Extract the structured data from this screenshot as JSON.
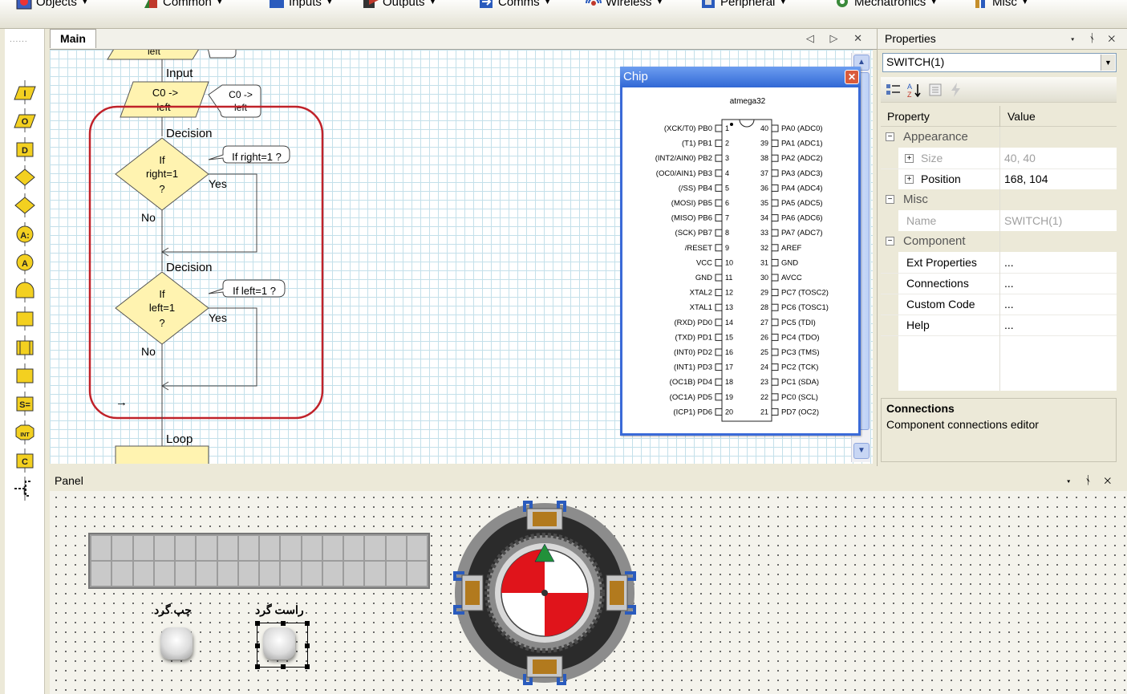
{
  "toolbar": {
    "items": [
      {
        "label": "Objects",
        "color": "#3b5fbf"
      },
      {
        "label": "Common",
        "color": "#2f7d2f"
      },
      {
        "label": "Inputs",
        "color": "#c0392b"
      },
      {
        "label": "Outputs",
        "color": "#b03a2e"
      },
      {
        "label": "Comms",
        "color": "#2a5bbd"
      },
      {
        "label": "Wireless",
        "color": "#c0392b"
      },
      {
        "label": "Peripheral",
        "color": "#2a5bbd"
      },
      {
        "label": "Mechatronics",
        "color": "#3a8a3a"
      },
      {
        "label": "Misc",
        "color": "#c58e2a"
      }
    ]
  },
  "palette": {
    "icons": [
      "input-icon",
      "output-icon",
      "delay-icon",
      "decision-icon",
      "switch-icon",
      "calculation-icon",
      "connection-point-icon",
      "macro-icon",
      "component-macro-icon",
      "loop-icon",
      "call-macro-icon",
      "string-icon",
      "interrupt-icon",
      "c-code-icon",
      "comment-icon"
    ],
    "labels": [
      "I",
      "O",
      "D",
      "",
      "",
      "A:",
      "A",
      "",
      "",
      "",
      "",
      "S=",
      "INT",
      "C",
      "[ "
    ]
  },
  "main_tab": {
    "label": "Main",
    "controls": "◁ ▷ ✕"
  },
  "flowchart": {
    "input_top_label": "left",
    "input_label": "Input",
    "input_text_1": "C0 ->",
    "input_text_2": "left",
    "input_comment_1": "C0 ->",
    "input_comment_2": "left",
    "decision1_label": "Decision",
    "decision1_text_1": "If",
    "decision1_text_2": "right=1",
    "decision1_text_3": "?",
    "decision1_comment": "If right=1 ?",
    "decision1_yes": "Yes",
    "decision1_no": "No",
    "decision2_label": "Decision",
    "decision2_text_1": "If",
    "decision2_text_2": "left=1",
    "decision2_text_3": "?",
    "decision2_comment": "If left=1 ?",
    "decision2_yes": "Yes",
    "decision2_no": "No",
    "arrow_marker": "→",
    "loop_label": "Loop"
  },
  "chip": {
    "title": "Chip",
    "part": "atmega32",
    "left_pins": [
      "(XCK/T0) PB0",
      "(T1) PB1",
      "(INT2/AIN0) PB2",
      "(OC0/AIN1) PB3",
      "(/SS) PB4",
      "(MOSI) PB5",
      "(MISO) PB6",
      "(SCK) PB7",
      "/RESET",
      "VCC",
      "GND",
      "XTAL2",
      "XTAL1",
      "(RXD) PD0",
      "(TXD) PD1",
      "(INT0) PD2",
      "(INT1) PD3",
      "(OC1B) PD4",
      "(OC1A) PD5",
      "(ICP1) PD6"
    ],
    "right_pins": [
      "PA0 (ADC0)",
      "PA1 (ADC1)",
      "PA2 (ADC2)",
      "PA3 (ADC3)",
      "PA4 (ADC4)",
      "PA5 (ADC5)",
      "PA6 (ADC6)",
      "PA7 (ADC7)",
      "AREF",
      "GND",
      "AVCC",
      "PC7 (TOSC2)",
      "PC6 (TOSC1)",
      "PC5 (TDI)",
      "PC4 (TDO)",
      "PC3 (TMS)",
      "PC2 (TCK)",
      "PC1 (SDA)",
      "PC0 (SCL)",
      "PD7 (OC2)"
    ]
  },
  "properties": {
    "title": "Properties",
    "header_controls": "▾ ᛀ ✕",
    "selected_object": "SWITCH(1)",
    "col_property": "Property",
    "col_value": "Value",
    "cat_appearance": "Appearance",
    "size_label": "Size",
    "size_value": "40, 40",
    "position_label": "Position",
    "position_value": "168, 104",
    "cat_misc": "Misc",
    "name_label": "Name",
    "name_value": "SWITCH(1)",
    "cat_component": "Component",
    "ext_label": "Ext Properties",
    "ext_value": "...",
    "connections_label": "Connections",
    "connections_value": "...",
    "custom_label": "Custom Code",
    "custom_value": "...",
    "help_label": "Help",
    "help_value": "...",
    "desc_title": "Connections",
    "desc_text": "Component connections editor"
  },
  "panel": {
    "title": "Panel",
    "controls": "▾ ᛀ ✕",
    "switch_left_label": "چپ گرد",
    "switch_right_label": "راست گرد"
  },
  "colors": {
    "flow_shape_fill": "#fff3b0",
    "selection_red": "#c0222a",
    "stepper_red": "#e0141b",
    "stepper_green": "#22913a"
  }
}
